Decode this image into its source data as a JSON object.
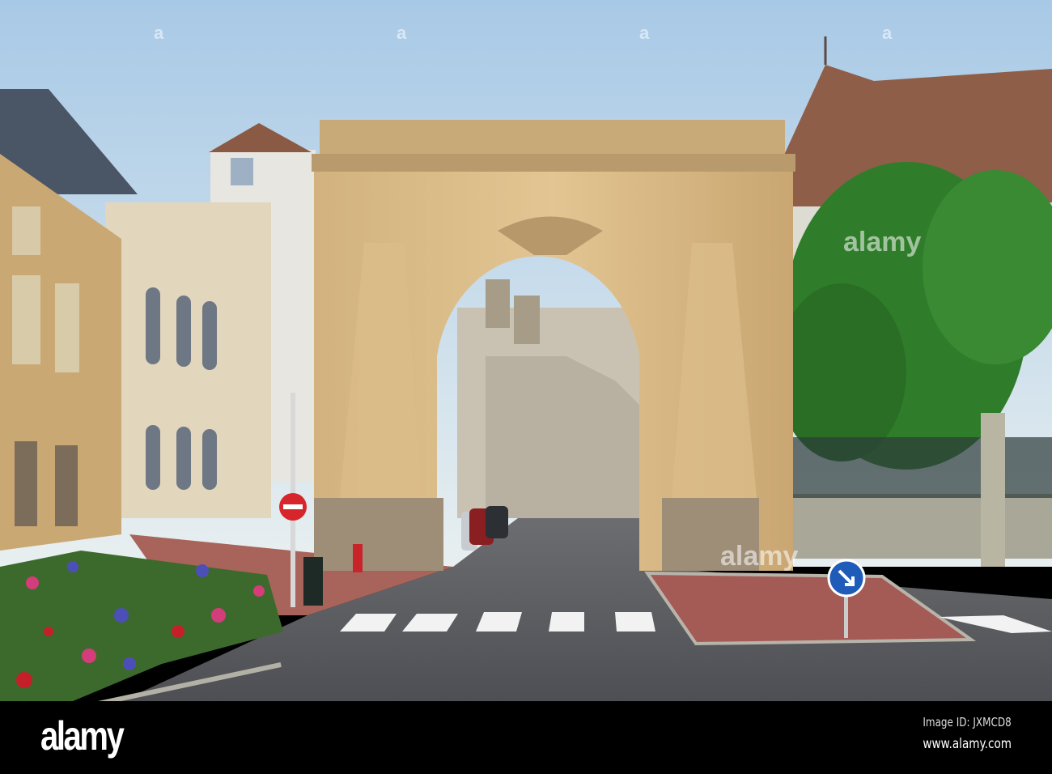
{
  "photo": {
    "colors": {
      "sky_top": "#a9cbe8",
      "sky_bottom": "#e6eef2",
      "stone": "#d9b982",
      "road": "#55565a",
      "tree": "#2f7d2a"
    },
    "signs": [
      {
        "name": "no-entry-sign",
        "color": "#d6262b"
      },
      {
        "name": "keep-right-sign",
        "color": "#1f5bb8"
      }
    ]
  },
  "watermark": {
    "text": "alamy",
    "overlay_text": "a"
  },
  "footer": {
    "logo": "alamy",
    "image_id": "Image ID: JXMCD8",
    "website": "www.alamy.com"
  }
}
